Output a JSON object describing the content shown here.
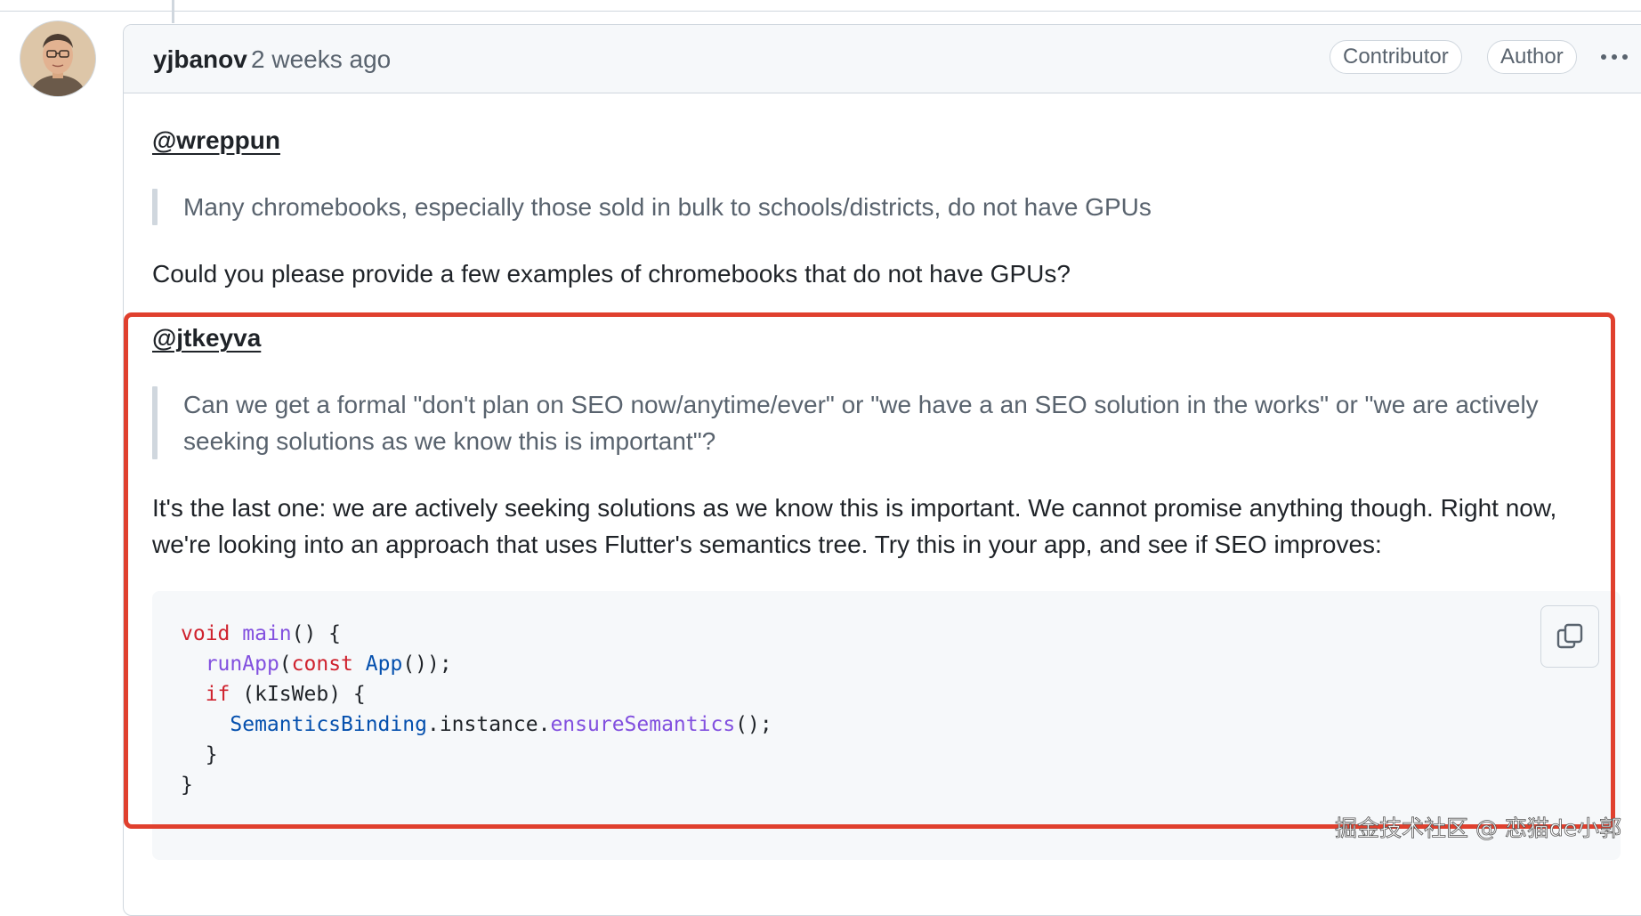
{
  "comment": {
    "author": "yjbanov",
    "timestamp": "2 weeks ago",
    "badges": [
      "Contributor",
      "Author"
    ],
    "sections": [
      {
        "mention": "@wreppun",
        "quote": [
          "Many chromebooks, especially those sold in bulk to schools/districts, do not have GPUs"
        ],
        "reply": [
          "Could you please provide a few examples of chromebooks that do not have GPUs?"
        ]
      },
      {
        "mention": "@jtkeyva",
        "quote": [
          "Can we get a formal \"don't plan on SEO now/anytime/ever\" or \"we have a an SEO solution in the works\" or \"we are actively",
          "seeking solutions as we know this is important\"?"
        ],
        "reply": [
          "It's the last one: we are actively seeking solutions as we know this is important. We cannot promise anything though. Right now,",
          "we're looking into an approach that uses Flutter's semantics tree. Try this in your app, and see if SEO improves:"
        ]
      }
    ],
    "code": {
      "kw_void": "void",
      "fn_main": "main",
      "fn_runApp": "runApp",
      "kw_const": "const",
      "cls_App": "App",
      "kw_if": "if",
      "var_kIsWeb": "kIsWeb",
      "cls_SemanticsBinding": "SemanticsBinding",
      "prop_instance": "instance",
      "fn_ensureSemantics": "ensureSemantics"
    }
  },
  "icons": {
    "more": "kebab-horizontal-icon",
    "copy": "copy-icon"
  },
  "watermark": "掘金技术社区 @ 恋猫de小郭",
  "colors": {
    "highlight_border": "#e0402e",
    "keyword": "#cf222e",
    "function": "#8250df",
    "class": "#0550ae"
  }
}
